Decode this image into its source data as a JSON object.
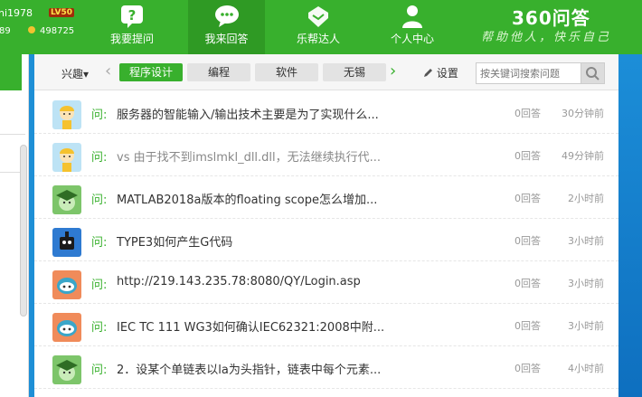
{
  "header": {
    "username": "ni1978",
    "level_badge": "LV50",
    "stat_left": "89",
    "stat_right": "498725",
    "nav": [
      {
        "label": "我要提问",
        "icon": "question-icon"
      },
      {
        "label": "我来回答",
        "icon": "chat-bubble-icon"
      },
      {
        "label": "乐帮达人",
        "icon": "handshake-icon"
      },
      {
        "label": "个人中心",
        "icon": "person-icon"
      }
    ],
    "brand": "360问答",
    "slogan": "帮助他人，快乐自己",
    "accent_color": "#38b02d"
  },
  "category_bar": {
    "interest_label": "兴趣▾",
    "tags": [
      "程序设计",
      "编程",
      "软件",
      "无锡"
    ],
    "active_tag": "程序设计",
    "settings_label": "设置",
    "search_placeholder": "按关键词搜索问题"
  },
  "questions": [
    {
      "prefix": "问:",
      "title": "服务器的智能输入/输出技术主要是为了实现什么...",
      "answers": "0回答",
      "time": "30分钟前",
      "avatar": "cartoon-girl-avatar",
      "visited": false
    },
    {
      "prefix": "问:",
      "title": "vs 由于找不到imslmkl_dll.dll，无法继续执行代...",
      "answers": "0回答",
      "time": "49分钟前",
      "avatar": "cartoon-girl-avatar",
      "visited": true
    },
    {
      "prefix": "问:",
      "title": "MATLAB2018a版本的floating scope怎么增加...",
      "answers": "0回答",
      "time": "2小时前",
      "avatar": "graduate-cap-avatar",
      "visited": false
    },
    {
      "prefix": "问:",
      "title": "TYPE3如何产生G代码",
      "answers": "0回答",
      "time": "3小时前",
      "avatar": "robot-avatar",
      "visited": false
    },
    {
      "prefix": "问:",
      "title": "http://219.143.235.78:8080/QY/Login.asp",
      "answers": "0回答",
      "time": "3小时前",
      "avatar": "blue-face-avatar",
      "visited": false
    },
    {
      "prefix": "问:",
      "title": "IEC TC 111 WG3如何确认IEC62321:2008中附...",
      "answers": "0回答",
      "time": "3小时前",
      "avatar": "blue-face-avatar",
      "visited": false
    },
    {
      "prefix": "问:",
      "title": "2．设某个单链表以la为头指针，链表中每个元素...",
      "answers": "0回答",
      "time": "4小时前",
      "avatar": "graduate-cap-avatar",
      "visited": false
    }
  ]
}
